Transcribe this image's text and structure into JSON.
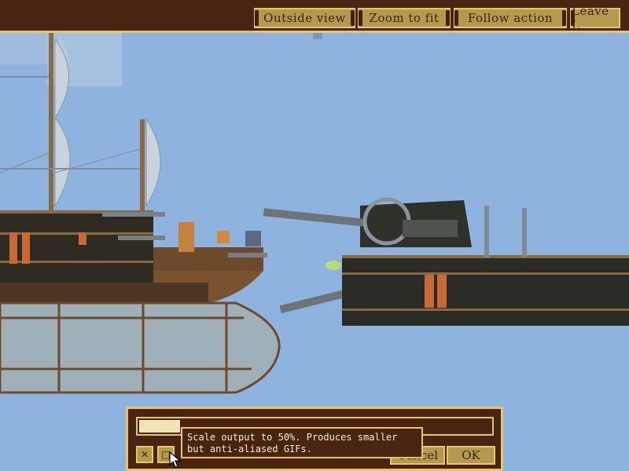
{
  "toolbar": {
    "outside_view_label": "Outside view",
    "zoom_to_fit_label": "Zoom to fit",
    "follow_action_label": "Follow action",
    "leave_label": "Leave L"
  },
  "export_panel": {
    "cancel_label": "Cancel",
    "ok_label": "OK",
    "scale_toggle_icon": "window-icon",
    "disabled_option_icon": "crossed-icon",
    "tooltip_text": "Scale output to 50%. Produces smaller but anti-aliased GIFs."
  },
  "colors": {
    "sky": "#8fb3df",
    "frame_brown": "#4a2412",
    "frame_gold": "#e8c46a",
    "button_tan": "#b59a4d"
  }
}
